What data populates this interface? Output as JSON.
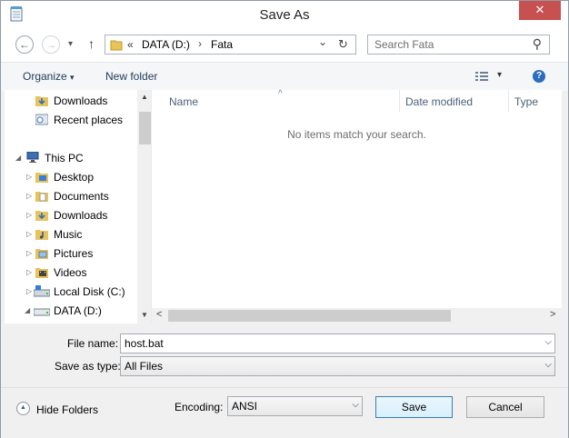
{
  "window": {
    "title": "Save As",
    "close_glyph": "✕"
  },
  "address": {
    "segments": [
      "«",
      "DATA (D:)",
      "›",
      "Fata"
    ],
    "back_glyph": "←",
    "forward_glyph": "→",
    "up_glyph": "↑",
    "recent_glyph": "▾",
    "dropdown_glyph": "⌄",
    "refresh_glyph": "↻"
  },
  "search": {
    "placeholder": "Search Fata",
    "icon_glyph": "⚲"
  },
  "toolbar": {
    "organize": "Organize",
    "organize_caret": "▾",
    "new_folder": "New folder",
    "view_caret": "▾",
    "help_glyph": "?"
  },
  "nav": {
    "items": [
      {
        "label": "Downloads",
        "icon": "downloads-folder-icon"
      },
      {
        "label": "Recent places",
        "icon": "recent-places-icon"
      },
      {
        "label": "This PC",
        "icon": "computer-icon"
      },
      {
        "label": "Desktop",
        "icon": "folder-icon"
      },
      {
        "label": "Documents",
        "icon": "folder-icon"
      },
      {
        "label": "Downloads",
        "icon": "downloads-folder-icon"
      },
      {
        "label": "Music",
        "icon": "music-folder-icon"
      },
      {
        "label": "Pictures",
        "icon": "pictures-folder-icon"
      },
      {
        "label": "Videos",
        "icon": "videos-folder-icon"
      },
      {
        "label": "Local Disk (C:)",
        "icon": "drive-icon"
      },
      {
        "label": "DATA (D:)",
        "icon": "drive-icon"
      }
    ],
    "scroll_up": "▲",
    "scroll_down": "▼",
    "expanded_glyph": "◢",
    "collapsed_glyph": "▷"
  },
  "columns": {
    "name": "Name",
    "date_modified": "Date modified",
    "type": "Type",
    "sort_glyph": "^"
  },
  "content": {
    "empty_message": "No items match your search.",
    "scroll_left": "<",
    "scroll_right": ">"
  },
  "form": {
    "file_name_label": "File name:",
    "file_name_value": "host.bat",
    "save_type_label": "Save as type:",
    "save_type_value": "All Files",
    "encoding_label": "Encoding:",
    "encoding_value": "ANSI"
  },
  "buttons": {
    "hide_folders": "Hide Folders",
    "hide_glyph": "▲",
    "save": "Save",
    "cancel": "Cancel"
  },
  "colors": {
    "close_red": "#c75050",
    "accent": "#3c7fb1",
    "folder_yellow": "#e8c35a"
  }
}
